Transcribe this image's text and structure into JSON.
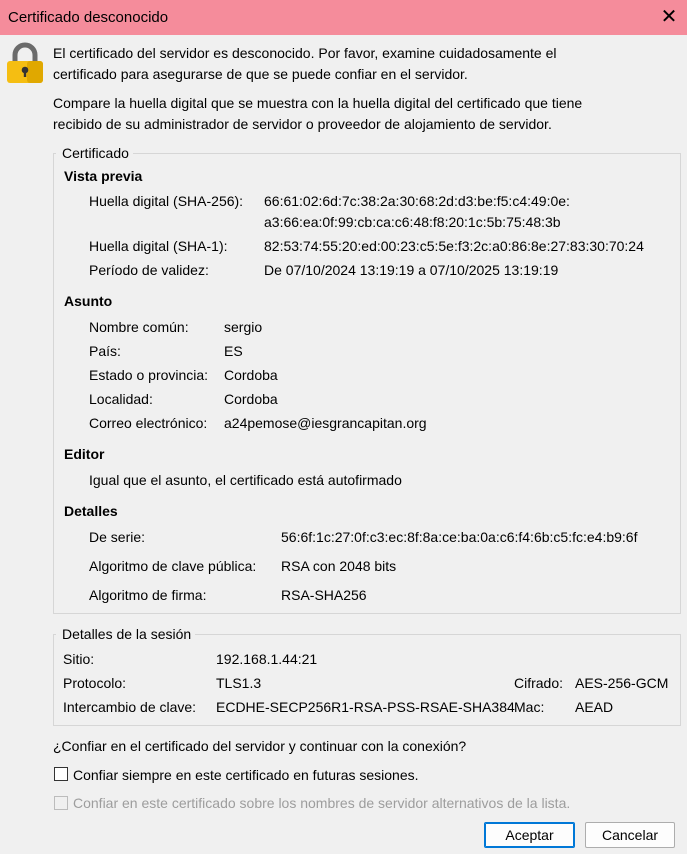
{
  "window": {
    "title": "Certificado desconocido",
    "close": "✕"
  },
  "intro": {
    "line1": "El certificado del servidor es desconocido. Por favor, examine cuidadosamente el",
    "line2": "certificado para asegurarse de que se puede confiar en el servidor.",
    "line3": "Compare la huella digital que se muestra con la huella digital del certificado que tiene",
    "line4": "recibido de su administrador de servidor o proveedor de alojamiento de servidor."
  },
  "certificate": {
    "legend": "Certificado",
    "preview": {
      "heading": "Vista previa",
      "sha256_label": "Huella digital (SHA-256):",
      "sha256_1": "66:61:02:6d:7c:38:2a:30:68:2d:d3:be:f5:c4:49:0e:",
      "sha256_2": "a3:66:ea:0f:99:cb:ca:c6:48:f8:20:1c:5b:75:48:3b",
      "sha1_label": "Huella digital (SHA-1):",
      "sha1": "82:53:74:55:20:ed:00:23:c5:5e:f3:2c:a0:86:8e:27:83:30:70:24",
      "validity_label": "Período de validez:",
      "validity": "De 07/10/2024 13:19:19 a 07/10/2025 13:19:19"
    },
    "subject": {
      "heading": "Asunto",
      "rows": [
        {
          "label": "Nombre común:",
          "value": "sergio"
        },
        {
          "label": "País:",
          "value": "ES"
        },
        {
          "label": "Estado o provincia:",
          "value": "Cordoba"
        },
        {
          "label": "Localidad:",
          "value": "Cordoba"
        },
        {
          "label": "Correo electrónico:",
          "value": "a24pemose@iesgrancapitan.org"
        }
      ]
    },
    "issuer": {
      "heading": "Editor",
      "text": "Igual que el asunto, el certificado está autofirmado"
    },
    "details": {
      "heading": "Detalles",
      "rows": [
        {
          "label": "De serie:",
          "value": "56:6f:1c:27:0f:c3:ec:8f:8a:ce:ba:0a:c6:f4:6b:c5:fc:e4:b9:6f"
        },
        {
          "label": "Algoritmo de clave pública:",
          "value": "RSA con 2048 bits"
        },
        {
          "label": "Algoritmo de firma:",
          "value": "RSA-SHA256"
        }
      ]
    }
  },
  "session": {
    "legend": "Detalles de la sesión",
    "site_label": "Sitio:",
    "site": "192.168.1.44:21",
    "protocol_label": "Protocolo:",
    "protocol": "TLS1.3",
    "cipher_label": "Cifrado:",
    "cipher": "AES-256-GCM",
    "kex_label": "Intercambio de clave:",
    "kex": "ECDHE-SECP256R1-RSA-PSS-RSAE-SHA384",
    "mac_label": "Mac:",
    "mac": "AEAD"
  },
  "question": "¿Confiar en el certificado del servidor y continuar con la conexión?",
  "options": {
    "always": "Confiar siempre en este certificado en futuras sesiones.",
    "alt_names": "Confiar en este certificado sobre los nombres de servidor alternativos de la lista."
  },
  "buttons": {
    "accept": "Aceptar",
    "cancel": "Cancelar"
  }
}
